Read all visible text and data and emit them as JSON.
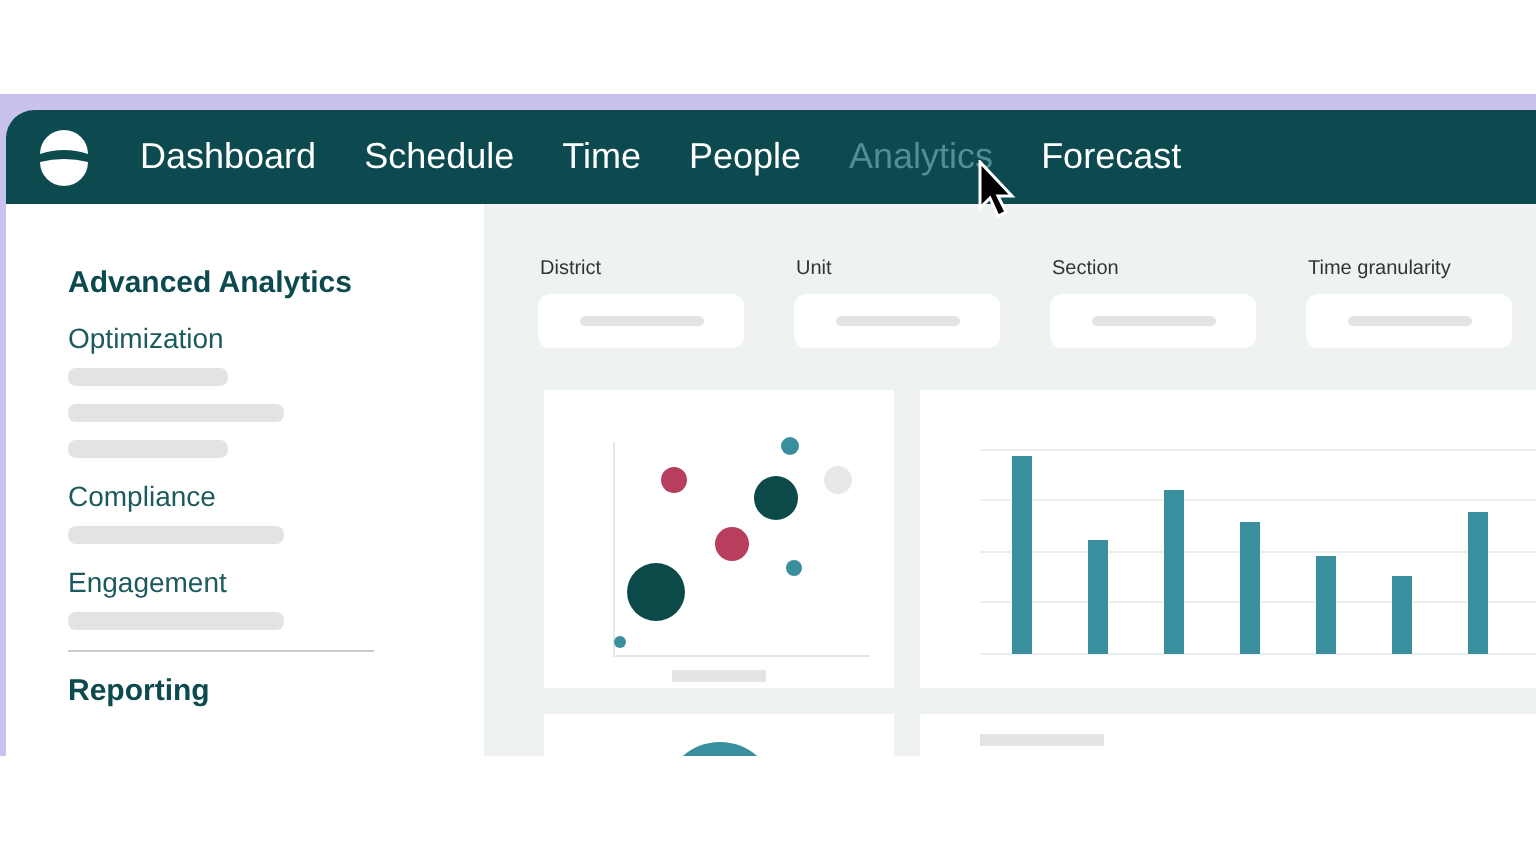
{
  "nav": {
    "items": [
      {
        "label": "Dashboard",
        "selected": false
      },
      {
        "label": "Schedule",
        "selected": false
      },
      {
        "label": "Time",
        "selected": false
      },
      {
        "label": "People",
        "selected": false
      },
      {
        "label": "Analytics",
        "selected": true
      },
      {
        "label": "Forecast",
        "selected": false
      }
    ]
  },
  "sidebar": {
    "sections": [
      {
        "title": "Advanced Analytics",
        "items": [
          {
            "label": "Optimization"
          },
          {
            "label": "Compliance"
          },
          {
            "label": "Engagement"
          }
        ]
      },
      {
        "title": "Reporting"
      }
    ]
  },
  "filters": [
    {
      "label": "District"
    },
    {
      "label": "Unit"
    },
    {
      "label": "Section"
    },
    {
      "label": "Time granularity"
    }
  ]
}
